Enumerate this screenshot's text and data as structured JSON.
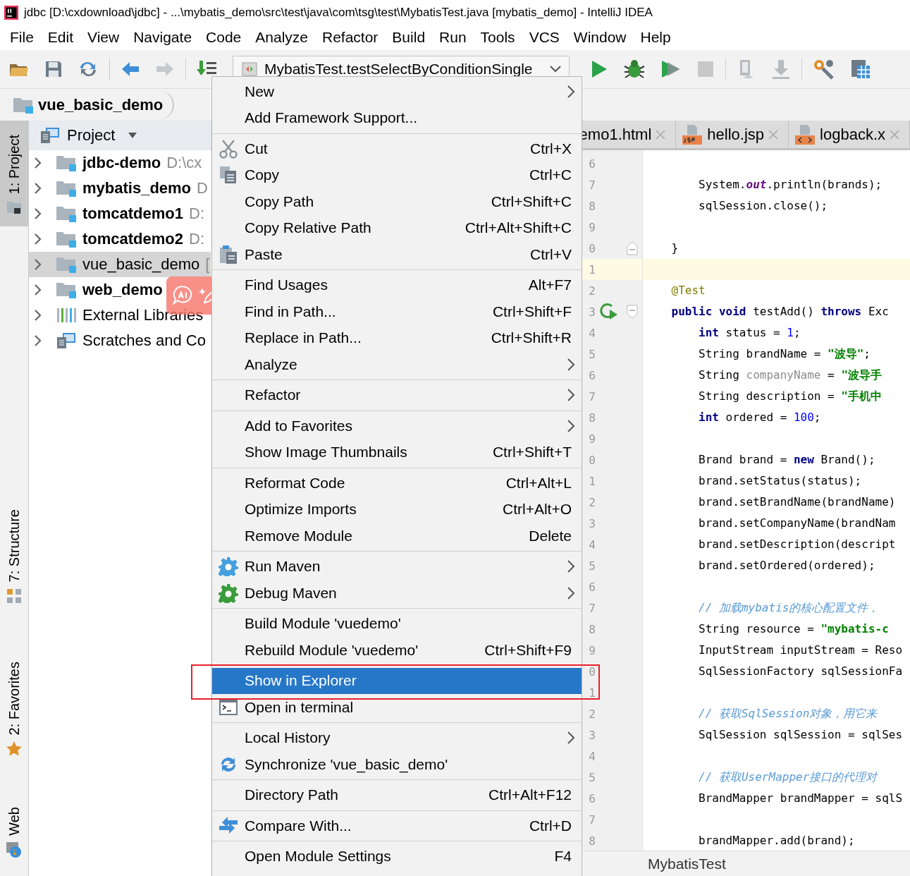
{
  "window": {
    "title": "jdbc [D:\\cxdownload\\jdbc] - ...\\mybatis_demo\\src\\test\\java\\com\\tsg\\test\\MybatisTest.java [mybatis_demo] - IntelliJ IDEA"
  },
  "menu_bar": [
    "File",
    "Edit",
    "View",
    "Navigate",
    "Code",
    "Analyze",
    "Refactor",
    "Build",
    "Run",
    "Tools",
    "VCS",
    "Window",
    "Help"
  ],
  "toolbar": {
    "run_config": "MybatisTest.testSelectByConditionSingle"
  },
  "breadcrumb": "vue_basic_demo",
  "tool_stripe": [
    {
      "label": "1: Project",
      "kind": "project",
      "selected": true
    },
    {
      "label": "7: Structure",
      "kind": "structure",
      "selected": false
    },
    {
      "label": "2: Favorites",
      "kind": "favorites",
      "selected": false
    },
    {
      "label": "Web",
      "kind": "web",
      "selected": false
    }
  ],
  "project_panel": {
    "title": "Project",
    "items": [
      {
        "name": "jdbc-demo",
        "path": "D:\\cx",
        "bold": true,
        "kind": "module",
        "selected": false
      },
      {
        "name": "mybatis_demo",
        "path": "D",
        "bold": true,
        "kind": "module",
        "selected": false
      },
      {
        "name": "tomcatdemo1",
        "path": "D:",
        "bold": true,
        "kind": "module",
        "selected": false
      },
      {
        "name": "tomcatdemo2",
        "path": "D:",
        "bold": true,
        "kind": "module",
        "selected": false
      },
      {
        "name": "vue_basic_demo",
        "path": "[",
        "bold": false,
        "kind": "module",
        "selected": true
      },
      {
        "name": "web_demo",
        "bold": true,
        "kind": "module",
        "selected": false
      },
      {
        "name": "External Libraries",
        "bold": false,
        "kind": "library",
        "selected": false
      },
      {
        "name": "Scratches and Co",
        "bold": false,
        "kind": "scratches",
        "selected": false
      }
    ]
  },
  "editor": {
    "tabs": [
      {
        "label": "emo1.html",
        "kind": "html"
      },
      {
        "label": "hello.jsp",
        "kind": "jsp"
      },
      {
        "label": "logback.x",
        "kind": "xml"
      }
    ],
    "lines": [
      {
        "number": "6",
        "kind": "plain",
        "current": false
      },
      {
        "number": "7",
        "kind": "plain",
        "current": false,
        "tokens": [
          {
            "kind": "plain",
            "text": "        System."
          },
          {
            "kind": "field",
            "text": "out"
          },
          {
            "kind": "plain",
            "text": ".println(brands);"
          }
        ]
      },
      {
        "number": "8",
        "kind": "plain",
        "current": false,
        "tokens": [
          {
            "kind": "plain",
            "text": "        sqlSession.close();"
          }
        ]
      },
      {
        "number": "9",
        "kind": "plain",
        "current": false
      },
      {
        "number": "0",
        "kind": "fold-end",
        "current": false,
        "tokens": [
          {
            "kind": "plain",
            "text": "    }"
          }
        ]
      },
      {
        "number": "1",
        "kind": "plain",
        "current": true
      },
      {
        "number": "2",
        "kind": "plain",
        "current": false,
        "tokens": [
          {
            "kind": "annotation",
            "text": "    @Test"
          }
        ]
      },
      {
        "number": "3",
        "kind": "run-fold",
        "current": false,
        "tokens": [
          {
            "kind": "keyword",
            "text": "    public void "
          },
          {
            "kind": "plain",
            "text": "testAdd() "
          },
          {
            "kind": "keyword",
            "text": "throws "
          },
          {
            "kind": "plain",
            "text": "Exc"
          }
        ]
      },
      {
        "number": "4",
        "kind": "plain",
        "current": false,
        "tokens": [
          {
            "kind": "keyword",
            "text": "        int "
          },
          {
            "kind": "plain",
            "text": "status = "
          },
          {
            "kind": "number",
            "text": "1"
          },
          {
            "kind": "plain",
            "text": ";"
          }
        ]
      },
      {
        "number": "5",
        "kind": "plain",
        "current": false,
        "tokens": [
          {
            "kind": "plain",
            "text": "        String brandName = "
          },
          {
            "kind": "string",
            "text": "\"波导\""
          },
          {
            "kind": "plain",
            "text": ";"
          }
        ]
      },
      {
        "number": "6",
        "kind": "plain",
        "current": false,
        "tokens": [
          {
            "kind": "plain",
            "text": "        String "
          },
          {
            "kind": "unused",
            "text": "companyName"
          },
          {
            "kind": "plain",
            "text": " = "
          },
          {
            "kind": "string",
            "text": "\"波导手"
          }
        ]
      },
      {
        "number": "7",
        "kind": "plain",
        "current": false,
        "tokens": [
          {
            "kind": "plain",
            "text": "        String description = "
          },
          {
            "kind": "string",
            "text": "\"手机中"
          }
        ]
      },
      {
        "number": "8",
        "kind": "plain",
        "current": false,
        "tokens": [
          {
            "kind": "keyword",
            "text": "        int "
          },
          {
            "kind": "plain",
            "text": "ordered = "
          },
          {
            "kind": "number",
            "text": "100"
          },
          {
            "kind": "plain",
            "text": ";"
          }
        ]
      },
      {
        "number": "9",
        "kind": "plain",
        "current": false
      },
      {
        "number": "0",
        "kind": "plain",
        "current": false,
        "tokens": [
          {
            "kind": "plain",
            "text": "        Brand brand = "
          },
          {
            "kind": "keyword",
            "text": "new "
          },
          {
            "kind": "plain",
            "text": "Brand();"
          }
        ]
      },
      {
        "number": "1",
        "kind": "plain",
        "current": false,
        "tokens": [
          {
            "kind": "plain",
            "text": "        brand.setStatus(status);"
          }
        ]
      },
      {
        "number": "2",
        "kind": "plain",
        "current": false,
        "tokens": [
          {
            "kind": "plain",
            "text": "        brand.setBrandName(brandName)"
          }
        ]
      },
      {
        "number": "3",
        "kind": "plain",
        "current": false,
        "tokens": [
          {
            "kind": "plain",
            "text": "        brand.setCompanyName(brandNam"
          }
        ]
      },
      {
        "number": "4",
        "kind": "plain",
        "current": false,
        "tokens": [
          {
            "kind": "plain",
            "text": "        brand.setDescription(descript"
          }
        ]
      },
      {
        "number": "5",
        "kind": "plain",
        "current": false,
        "tokens": [
          {
            "kind": "plain",
            "text": "        brand.setOrdered(ordered);"
          }
        ]
      },
      {
        "number": "6",
        "kind": "plain",
        "current": false
      },
      {
        "number": "7",
        "kind": "plain",
        "current": false,
        "tokens": [
          {
            "kind": "comment",
            "text": "        // 加载mybatis的核心配置文件，"
          }
        ]
      },
      {
        "number": "8",
        "kind": "plain",
        "current": false,
        "tokens": [
          {
            "kind": "plain",
            "text": "        String resource = "
          },
          {
            "kind": "string",
            "text": "\"mybatis-c"
          }
        ]
      },
      {
        "number": "9",
        "kind": "plain",
        "current": false,
        "tokens": [
          {
            "kind": "plain",
            "text": "        InputStream inputStream = Reso"
          }
        ]
      },
      {
        "number": "0",
        "kind": "plain",
        "current": false,
        "tokens": [
          {
            "kind": "plain",
            "text": "        SqlSessionFactory sqlSessionFa"
          }
        ]
      },
      {
        "number": "1",
        "kind": "plain",
        "current": false
      },
      {
        "number": "2",
        "kind": "plain",
        "current": false,
        "tokens": [
          {
            "kind": "comment",
            "text": "        // 获取SqlSession对象，用它来"
          }
        ]
      },
      {
        "number": "3",
        "kind": "plain",
        "current": false,
        "tokens": [
          {
            "kind": "plain",
            "text": "        SqlSession sqlSession = sqlSes"
          }
        ]
      },
      {
        "number": "4",
        "kind": "plain",
        "current": false
      },
      {
        "number": "5",
        "kind": "plain",
        "current": false,
        "tokens": [
          {
            "kind": "comment",
            "text": "        // 获取UserMapper接口的代理对"
          }
        ]
      },
      {
        "number": "6",
        "kind": "plain",
        "current": false,
        "tokens": [
          {
            "kind": "plain",
            "text": "        BrandMapper brandMapper = sqlS"
          }
        ]
      },
      {
        "number": "7",
        "kind": "plain",
        "current": false
      },
      {
        "number": "8",
        "kind": "plain",
        "current": false,
        "tokens": [
          {
            "kind": "plain",
            "text": "        brandMapper.add(brand);"
          }
        ]
      }
    ],
    "footer": "MybatisTest"
  },
  "context_menu": [
    {
      "kind": "item",
      "label": "New",
      "submenu": true,
      "selected": false
    },
    {
      "kind": "item",
      "label": "Add Framework Support...",
      "selected": false
    },
    {
      "kind": "separator"
    },
    {
      "kind": "cut",
      "label": "Cut",
      "shortcut": "Ctrl+X",
      "selected": false
    },
    {
      "kind": "copy",
      "label": "Copy",
      "shortcut": "Ctrl+C",
      "selected": false
    },
    {
      "kind": "item",
      "label": "Copy Path",
      "shortcut": "Ctrl+Shift+C",
      "selected": false
    },
    {
      "kind": "item",
      "label": "Copy Relative Path",
      "shortcut": "Ctrl+Alt+Shift+C",
      "selected": false
    },
    {
      "kind": "paste",
      "label": "Paste",
      "shortcut": "Ctrl+V",
      "selected": false
    },
    {
      "kind": "separator"
    },
    {
      "kind": "item",
      "label": "Find Usages",
      "shortcut": "Alt+F7",
      "selected": false
    },
    {
      "kind": "item",
      "label": "Find in Path...",
      "shortcut": "Ctrl+Shift+F",
      "selected": false
    },
    {
      "kind": "item",
      "label": "Replace in Path...",
      "shortcut": "Ctrl+Shift+R",
      "selected": false
    },
    {
      "kind": "item",
      "label": "Analyze",
      "submenu": true,
      "selected": false
    },
    {
      "kind": "separator"
    },
    {
      "kind": "item",
      "label": "Refactor",
      "submenu": true,
      "selected": false
    },
    {
      "kind": "separator"
    },
    {
      "kind": "item",
      "label": "Add to Favorites",
      "submenu": true,
      "selected": false
    },
    {
      "kind": "item",
      "label": "Show Image Thumbnails",
      "shortcut": "Ctrl+Shift+T",
      "selected": false
    },
    {
      "kind": "separator"
    },
    {
      "kind": "item",
      "label": "Reformat Code",
      "shortcut": "Ctrl+Alt+L",
      "selected": false
    },
    {
      "kind": "item",
      "label": "Optimize Imports",
      "shortcut": "Ctrl+Alt+O",
      "selected": false
    },
    {
      "kind": "item",
      "label": "Remove Module",
      "shortcut": "Delete",
      "selected": false
    },
    {
      "kind": "separator"
    },
    {
      "kind": "maven-run",
      "label": "Run Maven",
      "submenu": true,
      "selected": false
    },
    {
      "kind": "maven-debug",
      "label": "Debug Maven",
      "submenu": true,
      "selected": false
    },
    {
      "kind": "separator"
    },
    {
      "kind": "item",
      "label": "Build Module 'vuedemo'",
      "selected": false
    },
    {
      "kind": "item",
      "label": "Rebuild Module 'vuedemo'",
      "shortcut": "Ctrl+Shift+F9",
      "selected": false
    },
    {
      "kind": "separator"
    },
    {
      "kind": "item",
      "label": "Show in Explorer",
      "selected": true
    },
    {
      "kind": "terminal",
      "label": "Open in terminal",
      "selected": false
    },
    {
      "kind": "separator"
    },
    {
      "kind": "item",
      "label": "Local History",
      "submenu": true,
      "selected": false
    },
    {
      "kind": "sync",
      "label": "Synchronize 'vue_basic_demo'",
      "selected": false
    },
    {
      "kind": "separator"
    },
    {
      "kind": "item",
      "label": "Directory Path",
      "shortcut": "Ctrl+Alt+F12",
      "selected": false
    },
    {
      "kind": "separator"
    },
    {
      "kind": "compare",
      "label": "Compare With...",
      "shortcut": "Ctrl+D",
      "selected": false
    },
    {
      "kind": "separator"
    },
    {
      "kind": "item",
      "label": "Open Module Settings",
      "shortcut": "F4",
      "selected": false
    }
  ]
}
